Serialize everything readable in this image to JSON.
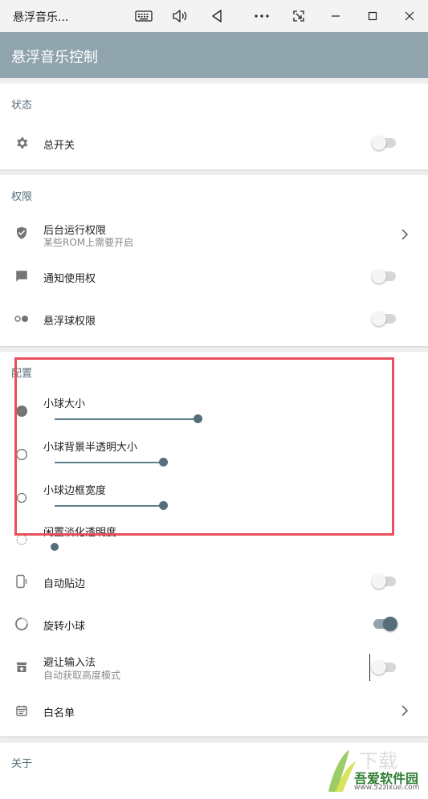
{
  "window": {
    "title": "悬浮音乐..."
  },
  "appbar": {
    "title": "悬浮音乐控制"
  },
  "sections": {
    "status": {
      "title": "状态",
      "master_switch": {
        "label": "总开关",
        "on": false
      }
    },
    "permissions": {
      "title": "权限",
      "background": {
        "label": "后台运行权限",
        "sub": "某些ROM上需要开启"
      },
      "notification": {
        "label": "通知使用权",
        "on": false
      },
      "floating": {
        "label": "悬浮球权限",
        "on": false
      }
    },
    "config": {
      "title": "配置",
      "ball_size": {
        "label": "小球大小",
        "value": 0.8
      },
      "bg_alpha": {
        "label": "小球背景半透明大小",
        "value": 0.61
      },
      "border_width": {
        "label": "小球边框宽度",
        "value": 0.61
      },
      "idle_fade": {
        "label": "闲置淡化透明度",
        "value": 0.0
      },
      "auto_edge": {
        "label": "自动贴边",
        "on": false
      },
      "rotate": {
        "label": "旋转小球",
        "on": true
      },
      "avoid_ime": {
        "label": "避让输入法",
        "sub": "自动获取高度模式",
        "on": false
      },
      "whitelist": {
        "label": "白名单"
      }
    },
    "about": {
      "title": "关于"
    }
  },
  "watermark": {
    "text_main": "吾爱软件园",
    "text_url": "www.52zixue.com"
  },
  "colors": {
    "appbar": "#90a4ae",
    "accent": "#546e7a",
    "highlight": "#e8505b"
  }
}
